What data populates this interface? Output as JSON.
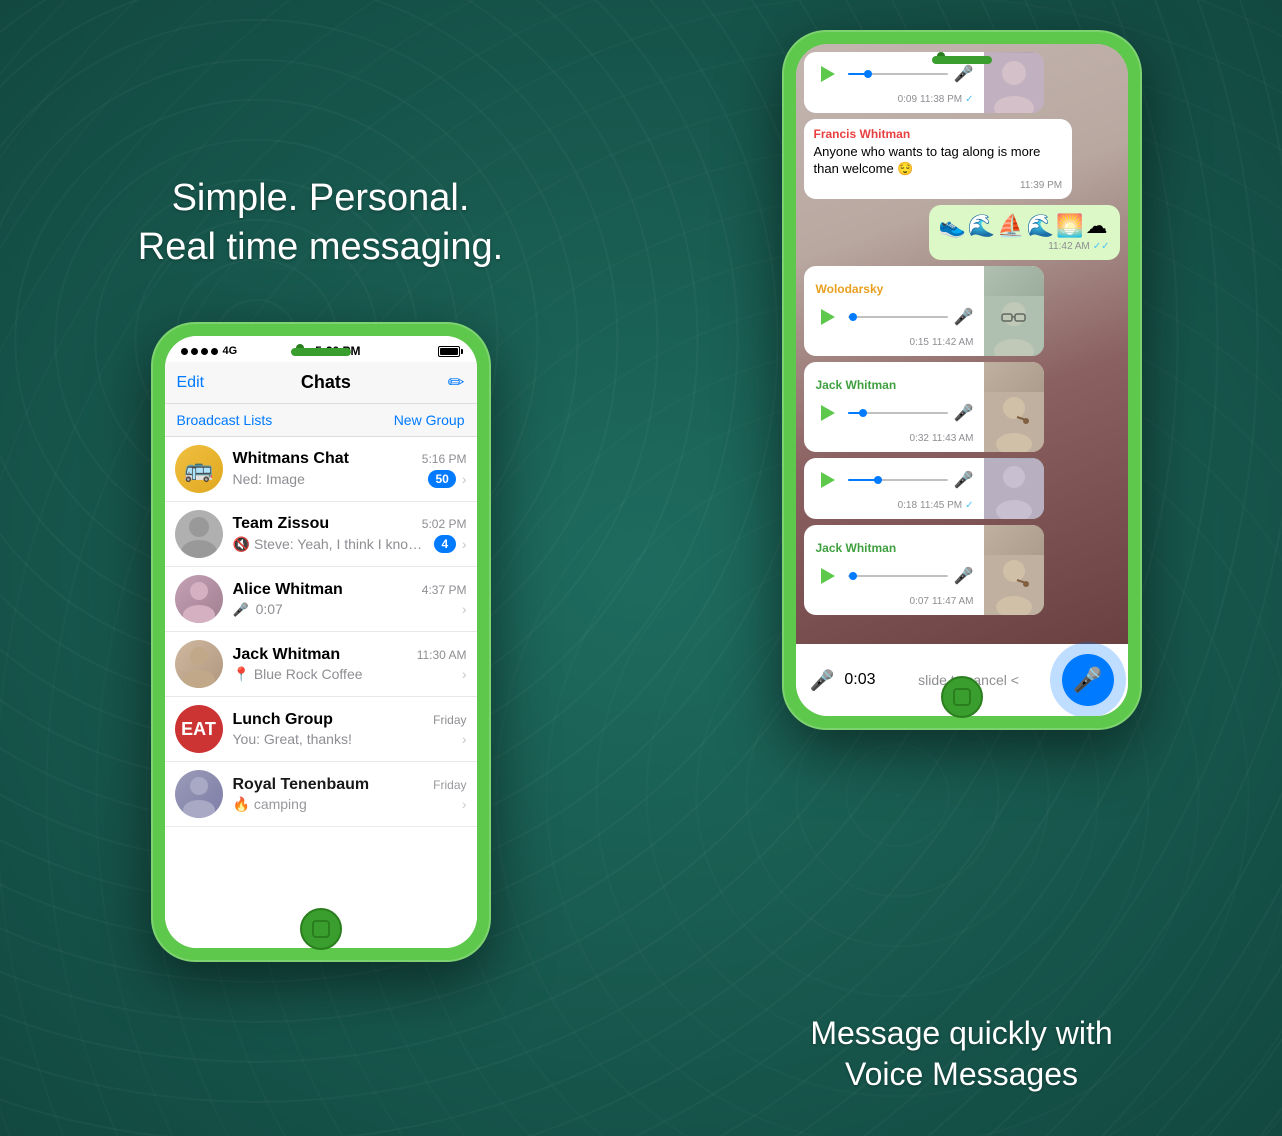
{
  "left": {
    "hero": "Simple. Personal.\nReal time messaging.",
    "phone": {
      "status": {
        "signal": "●●●●● 4G",
        "time": "5:20 PM",
        "battery": "full"
      },
      "nav": {
        "edit": "Edit",
        "title": "Chats",
        "compose_icon": "✏"
      },
      "broadcast": {
        "lists": "Broadcast Lists",
        "new_group": "New Group"
      },
      "chats": [
        {
          "name": "Whitmans Chat",
          "time": "5:16 PM",
          "preview_sender": "Ned:",
          "preview_text": "Image",
          "badge": "50",
          "avatar_type": "bus"
        },
        {
          "name": "Team Zissou",
          "time": "5:02 PM",
          "preview_sender": "Steve:",
          "preview_text": "Yeah, I think I know wha...",
          "badge": "4",
          "muted": true,
          "avatar_type": "group"
        },
        {
          "name": "Alice Whitman",
          "time": "4:37 PM",
          "preview_text": "🎤 0:07",
          "avatar_type": "alice",
          "badge": ""
        },
        {
          "name": "Jack Whitman",
          "time": "11:30 AM",
          "preview_text": "📍 Blue Rock Coffee",
          "avatar_type": "jack",
          "badge": ""
        },
        {
          "name": "Lunch Group",
          "time": "Friday",
          "preview_sender": "You:",
          "preview_text": "Great, thanks!",
          "avatar_type": "eat",
          "badge": ""
        },
        {
          "name": "Royal Tenenbaum",
          "time": "Friday",
          "preview_text": "🔥 camping",
          "avatar_type": "royal",
          "badge": ""
        }
      ]
    }
  },
  "right": {
    "messages": [
      {
        "type": "voice_photo",
        "side": "received",
        "has_photo": true,
        "photo_type": "woman",
        "time": "11:38 PM",
        "duration": "0:09",
        "check": true
      },
      {
        "type": "text",
        "side": "received",
        "sender": "Francis Whitman",
        "sender_color": "francis",
        "text": "Anyone who wants to tag along is more than welcome 😌",
        "time": "11:39 PM",
        "check": false
      },
      {
        "type": "emoji",
        "side": "sent",
        "text": "👟🌊⛵🌊🌅☁",
        "time": "11:42 AM",
        "check": true
      },
      {
        "type": "voice_photo",
        "side": "received",
        "sender": "Wolodarsky",
        "sender_color": "wolodarsky",
        "has_photo": true,
        "photo_type": "man_glasses",
        "time": "11:42 AM",
        "duration": "0:15",
        "check": false
      },
      {
        "type": "voice_photo",
        "side": "received",
        "sender": "Jack Whitman",
        "sender_color": "jack",
        "has_photo": true,
        "photo_type": "man_pipe",
        "time": "11:43 AM",
        "duration": "0:32",
        "check": false
      },
      {
        "type": "voice_photo",
        "side": "received",
        "has_photo": true,
        "photo_type": "woman2",
        "time": "11:45 PM",
        "duration": "0:18",
        "check": true
      },
      {
        "type": "voice_photo",
        "side": "received",
        "sender": "Jack Whitman",
        "sender_color": "jack",
        "has_photo": true,
        "photo_type": "man_pipe",
        "time": "11:47 AM",
        "duration": "0:07",
        "check": false
      }
    ],
    "recording": {
      "time": "0:03",
      "slide_text": "slide to cancel <"
    },
    "footer": "Message quickly with\nVoice Messages"
  }
}
